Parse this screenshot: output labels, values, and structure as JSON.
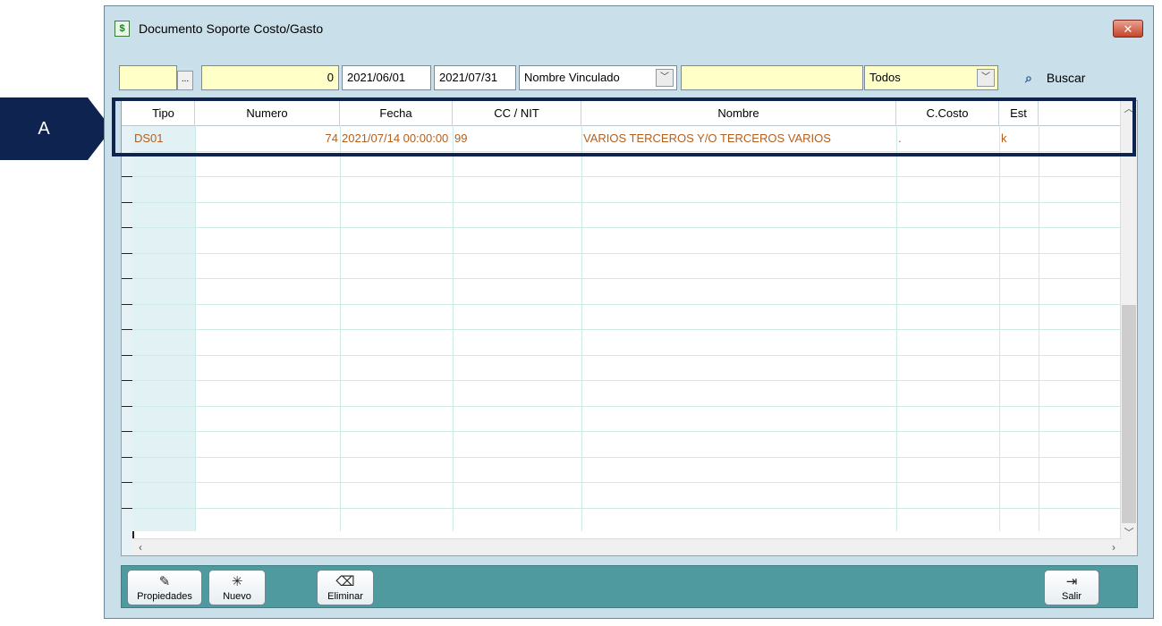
{
  "annotation": {
    "label": "A",
    "color": "#0f2350"
  },
  "window": {
    "title": "Documento Soporte Costo/Gasto",
    "icon": "document-dollar-icon",
    "close_label": "✕"
  },
  "filters": {
    "code": "",
    "ellipsis": "...",
    "number": "0",
    "date_from": "2021/06/01",
    "date_to": "2021/07/31",
    "field_select": "Nombre Vinculado",
    "search_text": "",
    "status_select": "Todos",
    "search_button": "Buscar"
  },
  "grid": {
    "columns": [
      "Tipo",
      "Numero",
      "Fecha",
      "CC / NIT",
      "Nombre",
      "C.Costo",
      "Est"
    ],
    "rows": [
      {
        "tipo": "DS01",
        "numero": "74",
        "fecha": "2021/07/14 00:00:00",
        "nit": "99",
        "nombre": "VARIOS TERCEROS Y/O TERCEROS VARIOS",
        "ccosto": ".",
        "est": "k"
      }
    ],
    "row_color": "#b45f1e"
  },
  "toolbar": {
    "propiedades": "Propiedades",
    "nuevo": "Nuevo",
    "eliminar": "Eliminar",
    "salir": "Salir"
  }
}
